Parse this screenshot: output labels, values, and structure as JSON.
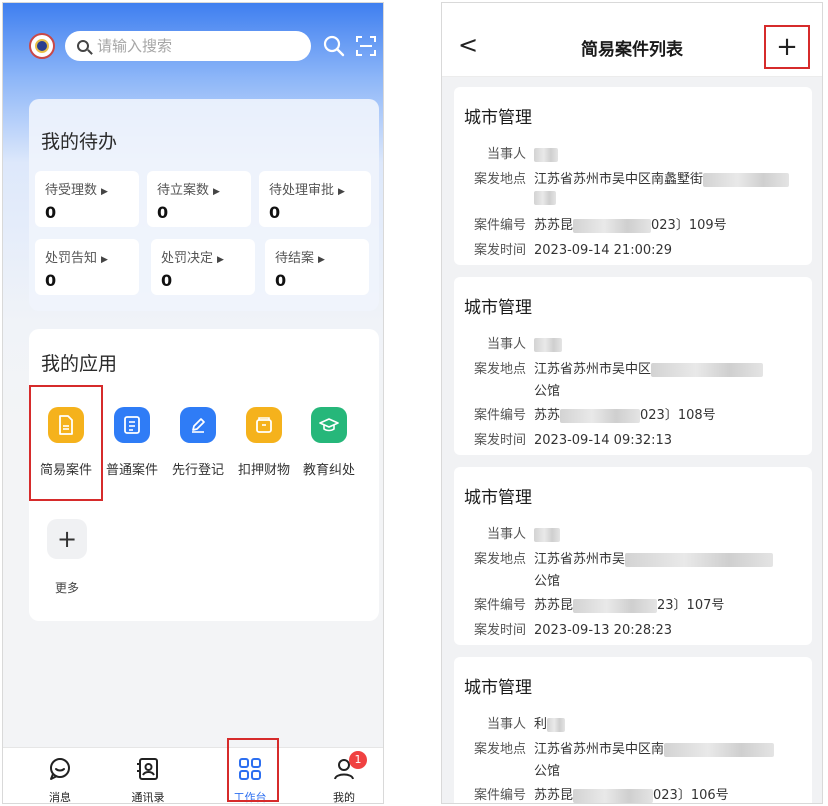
{
  "left_screen": {
    "search": {
      "placeholder": "请输入搜索"
    },
    "todo": {
      "title": "我的待办",
      "items": [
        {
          "label": "待受理数",
          "count": "0"
        },
        {
          "label": "待立案数",
          "count": "0"
        },
        {
          "label": "待处理审批",
          "count": "0"
        },
        {
          "label": "处罚告知",
          "count": "0"
        },
        {
          "label": "处罚决定",
          "count": "0"
        },
        {
          "label": "待结案",
          "count": "0"
        }
      ]
    },
    "apps": {
      "title": "我的应用",
      "items": [
        {
          "label": "简易案件",
          "icon": "document-icon",
          "color": "#f5b21c"
        },
        {
          "label": "普通案件",
          "icon": "clipboard-icon",
          "color": "#2f7cf6"
        },
        {
          "label": "先行登记",
          "icon": "pen-icon",
          "color": "#2f7cf6"
        },
        {
          "label": "扣押财物",
          "icon": "box-icon",
          "color": "#f5b21c"
        },
        {
          "label": "教育纠处",
          "icon": "graduation-cap-icon",
          "color": "#26b77a"
        }
      ],
      "more_label": "更多"
    },
    "bottom_nav": [
      {
        "label": "消息",
        "icon": "chat-icon",
        "active": false
      },
      {
        "label": "通讯录",
        "icon": "contacts-icon",
        "active": false
      },
      {
        "label": "工作台",
        "icon": "grid-icon",
        "active": true
      },
      {
        "label": "我的",
        "icon": "user-icon",
        "active": false,
        "badge": "1"
      }
    ],
    "accent_color": "#2d6ff0",
    "highlight_color": "#d62b2b"
  },
  "right_screen": {
    "back_glyph": "<",
    "title": "简易案件列表",
    "add_glyph": "+",
    "labels": {
      "party": "当事人",
      "location": "案发地点",
      "case_no": "案件编号",
      "time": "案发时间"
    },
    "cases": [
      {
        "category": "城市管理",
        "location_start": "江苏省苏州市吴中区南蠡墅街",
        "location_line2": "",
        "case_no_prefix": "苏苏昆",
        "case_no_suffix": "023〕109号",
        "time": "2023-09-14 21:00:29"
      },
      {
        "category": "城市管理",
        "location_start": "江苏省苏州市吴中区",
        "location_line2": "公馆",
        "case_no_prefix": "苏苏",
        "case_no_suffix": "023〕108号",
        "time": "2023-09-14 09:32:13"
      },
      {
        "category": "城市管理",
        "location_start": "江苏省苏州市吴",
        "location_line2": "公馆",
        "case_no_prefix": "苏苏昆",
        "case_no_suffix": "23〕107号",
        "time": "2023-09-13 20:28:23"
      },
      {
        "category": "城市管理",
        "party_visible": "利",
        "location_start": "江苏省苏州市吴中区南",
        "location_line2": "公馆",
        "case_no_prefix": "苏苏昆",
        "case_no_suffix": "023〕106号",
        "time": ""
      }
    ]
  }
}
